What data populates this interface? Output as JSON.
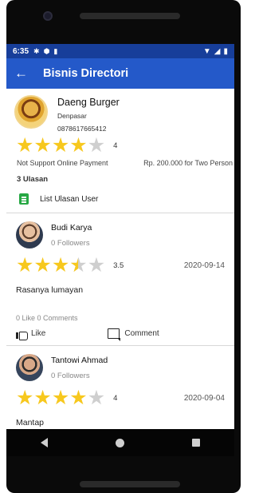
{
  "status_bar": {
    "time": "6:35"
  },
  "app_bar": {
    "title": "Bisnis Directori"
  },
  "business": {
    "name": "Daeng Burger",
    "city": "Denpasar",
    "phone": "0878617665412",
    "rating": 4,
    "rating_label": "4",
    "payment_note": "Not Support Online Payment",
    "price_note": "Rp. 200.000 for Two Person",
    "review_count_label": "3  Ulasan",
    "review_list_label": "List Ulasan User"
  },
  "reviews": [
    {
      "user": "Budi Karya",
      "followers": "0  Followers",
      "rating": 3.5,
      "rating_label": "3.5",
      "date": "2020-09-14",
      "text": "Rasanya lumayan",
      "counts": "0 Like   0 Comments",
      "like_label": "Like",
      "comment_label": "Comment"
    },
    {
      "user": "Tantowi Ahmad",
      "followers": "0  Followers",
      "rating": 4,
      "rating_label": "4",
      "date": "2020-09-04",
      "text": "Mantap"
    }
  ],
  "colors": {
    "status_bar": "#173e9a",
    "app_bar": "#2459c9",
    "star": "#f7c81e",
    "star_empty": "#cfcfcf",
    "clipboard_icon": "#27a844"
  }
}
